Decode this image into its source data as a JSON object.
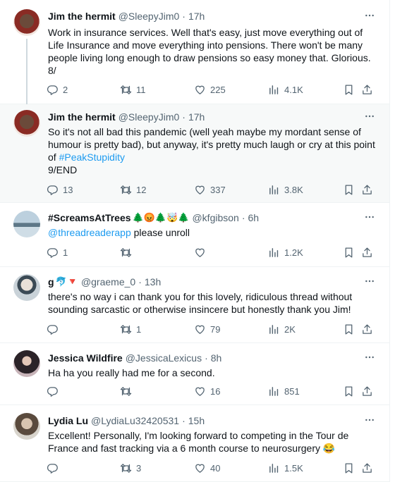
{
  "tweets": [
    {
      "name": "Jim the hermit",
      "handle": "@SleepyJim0",
      "time": "17h",
      "text": "Work in insurance services. Well that's easy, just move everything out of Life Insurance and move everything into pensions. There won't be many people living long enough to draw pensions so easy money that. Glorious.\n8/",
      "replies": "2",
      "retweets": "11",
      "likes": "225",
      "views": "4.1K"
    },
    {
      "name": "Jim the hermit",
      "handle": "@SleepyJim0",
      "time": "17h",
      "text": "So it's not all bad this pandemic (well yeah maybe my mordant sense of humour is pretty bad), but anyway, it's pretty much laugh or cry at this point of ",
      "hashtag": "#PeakStupidity",
      "end": "9/END",
      "replies": "13",
      "retweets": "12",
      "likes": "337",
      "views": "3.8K"
    },
    {
      "name": "#ScreamsAtTrees",
      "name_emojis": "🌲😡🌲🤯🌲",
      "handle": "@kfgibson",
      "time": "6h",
      "mention": "@threadreaderapp",
      "text": " please unroll",
      "replies": "1",
      "retweets": "",
      "likes": "",
      "views": "1.2K"
    },
    {
      "name": "g",
      "name_emojis": "🐬🔻",
      "handle": "@graeme_0",
      "time": "13h",
      "text": "there's no way i can thank you for this lovely, ridiculous thread without sounding sarcastic or otherwise insincere but honestly thank you Jim!",
      "replies": "",
      "retweets": "1",
      "likes": "79",
      "views": "2K"
    },
    {
      "name": "Jessica Wildfire",
      "handle": "@JessicaLexicus",
      "time": "8h",
      "text": "Ha ha you really had me for a second.",
      "replies": "",
      "retweets": "",
      "likes": "16",
      "views": "851"
    },
    {
      "name": "Lydia Lu",
      "handle": "@LydiaLu32420531",
      "time": "15h",
      "text": "Excellent! Personally, I'm looking forward to competing in the Tour de France and fast tracking via a 6 month course to neurosurgery 😂",
      "replies": "",
      "retweets": "3",
      "likes": "40",
      "views": "1.5K"
    }
  ],
  "colors": {
    "accent": "#1d9bf0",
    "text": "#0f1419",
    "muted": "#536471",
    "highlight_bg": "#f7f9f9",
    "divider": "#eff3f4"
  },
  "icons": [
    "reply-icon",
    "retweet-icon",
    "like-icon",
    "views-icon",
    "bookmark-icon",
    "share-icon",
    "more-icon"
  ]
}
